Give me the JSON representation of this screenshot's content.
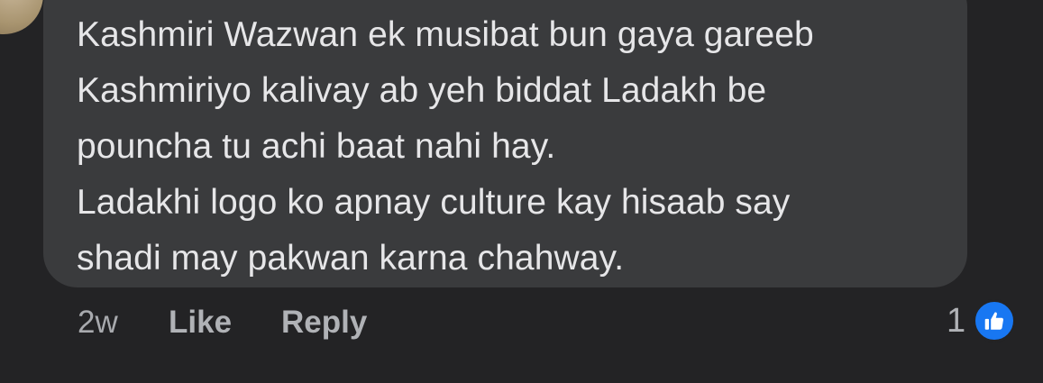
{
  "comment": {
    "lines": [
      "Kashmiri Wazwan ek musibat bun gaya gareeb",
      "Kashmiriyo kalivay ab yeh biddat Ladakh be",
      "pouncha tu achi baat nahi hay.",
      "Ladakhi logo ko apnay culture kay hisaab say",
      "shadi may pakwan karna chahway."
    ]
  },
  "actions": {
    "time": "2w",
    "like_label": "Like",
    "reply_label": "Reply"
  },
  "reactions": {
    "count": "1",
    "icon": "thumbs-up-icon",
    "color": "#1877f2"
  }
}
